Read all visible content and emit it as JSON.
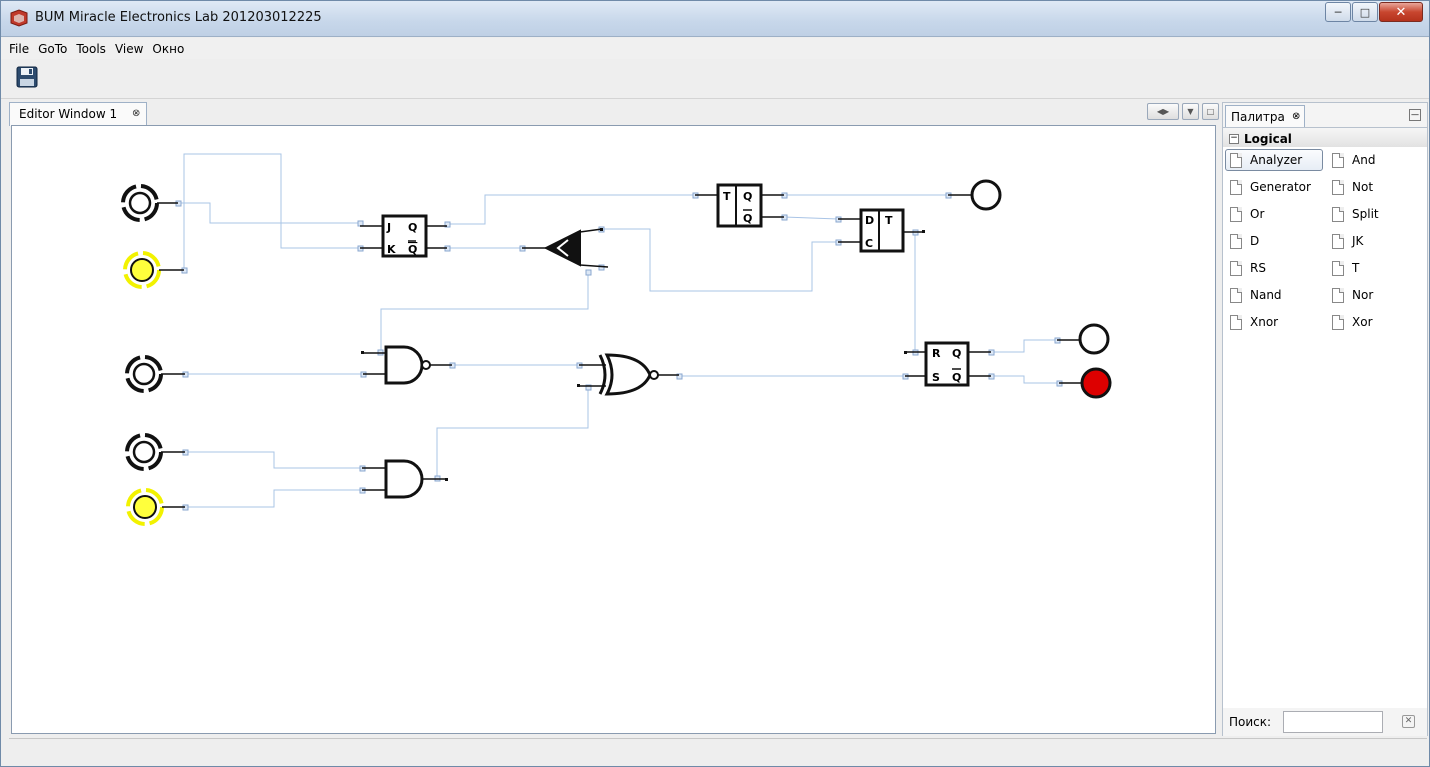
{
  "window": {
    "title": "BUM Miracle Electronics Lab 201203012225"
  },
  "menu": [
    "File",
    "GoTo",
    "Tools",
    "View",
    "Окно"
  ],
  "editor": {
    "tab_label": "Editor Window 1",
    "tab_close": "⊗"
  },
  "palette": {
    "tab_label": "Палитра",
    "tab_close": "⊗",
    "category": "Logical",
    "items": [
      "Analyzer",
      "And",
      "Generator",
      "Not",
      "Or",
      "Split",
      "D",
      "JK",
      "RS",
      "T",
      "Nand",
      "Nor",
      "Xnor",
      "Xor"
    ],
    "selected": "Analyzer",
    "search_label": "Поиск:",
    "search_value": ""
  },
  "circuit": {
    "inputs": [
      {
        "id": "in1",
        "state": "off"
      },
      {
        "id": "in2",
        "state": "on"
      },
      {
        "id": "in3",
        "state": "off"
      },
      {
        "id": "in4",
        "state": "off"
      },
      {
        "id": "in5",
        "state": "on"
      }
    ],
    "outputs": [
      {
        "id": "out1",
        "state": "off"
      },
      {
        "id": "out2",
        "state": "off"
      },
      {
        "id": "out3",
        "state": "on"
      }
    ],
    "jk": {
      "pins": [
        "J",
        "K",
        "Q",
        "Q"
      ]
    },
    "t": {
      "pins": [
        "T",
        "Q",
        "Q"
      ]
    },
    "d": {
      "pins": [
        "D",
        "C",
        "T"
      ]
    },
    "rs": {
      "pins": [
        "R",
        "S",
        "Q",
        "Q"
      ]
    },
    "colors": {
      "on_fill": "#ffff3c",
      "on_glow": "#f2f200",
      "lamp_on": "#dd0000",
      "wire": "#a9c4e6"
    }
  }
}
